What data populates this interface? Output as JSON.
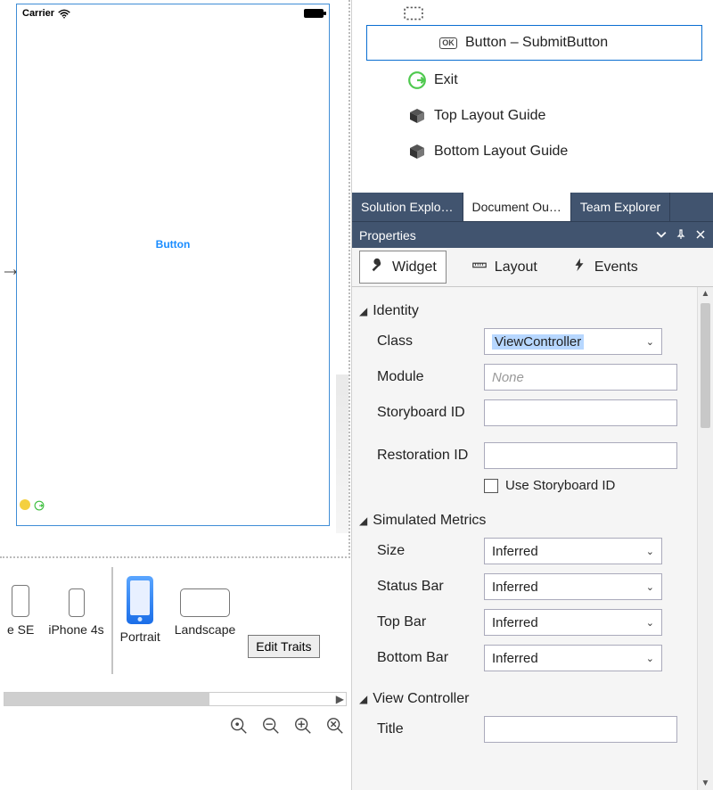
{
  "designer": {
    "status": {
      "carrier": "Carrier"
    },
    "button_label": "Button",
    "devices": {
      "se": "e SE",
      "iphone4s": "iPhone 4s",
      "portrait": "Portrait",
      "landscape": "Landscape"
    },
    "edit_traits": "Edit Traits"
  },
  "outline": {
    "items": [
      {
        "label": "Button  –  SubmitButton",
        "icon": "ok",
        "selected": true
      },
      {
        "label": "Exit",
        "icon": "exit"
      },
      {
        "label": "Top Layout Guide",
        "icon": "cube"
      },
      {
        "label": "Bottom Layout Guide",
        "icon": "cube"
      }
    ]
  },
  "panel_tabs": {
    "solution": "Solution Explo…",
    "document": "Document Ou…",
    "team": "Team Explorer"
  },
  "properties": {
    "title": "Properties",
    "tabs": {
      "widget": "Widget",
      "layout": "Layout",
      "events": "Events"
    },
    "identity": {
      "header": "Identity",
      "class_label": "Class",
      "class_value": "ViewController",
      "module_label": "Module",
      "module_placeholder": "None",
      "storyboard_label": "Storyboard ID",
      "restoration_label": "Restoration ID",
      "use_storyboard_label": "Use Storyboard ID"
    },
    "simulated": {
      "header": "Simulated Metrics",
      "size_label": "Size",
      "size_value": "Inferred",
      "statusbar_label": "Status Bar",
      "statusbar_value": "Inferred",
      "topbar_label": "Top Bar",
      "topbar_value": "Inferred",
      "bottombar_label": "Bottom Bar",
      "bottombar_value": "Inferred"
    },
    "viewcontroller": {
      "header": "View Controller",
      "title_label": "Title"
    }
  }
}
